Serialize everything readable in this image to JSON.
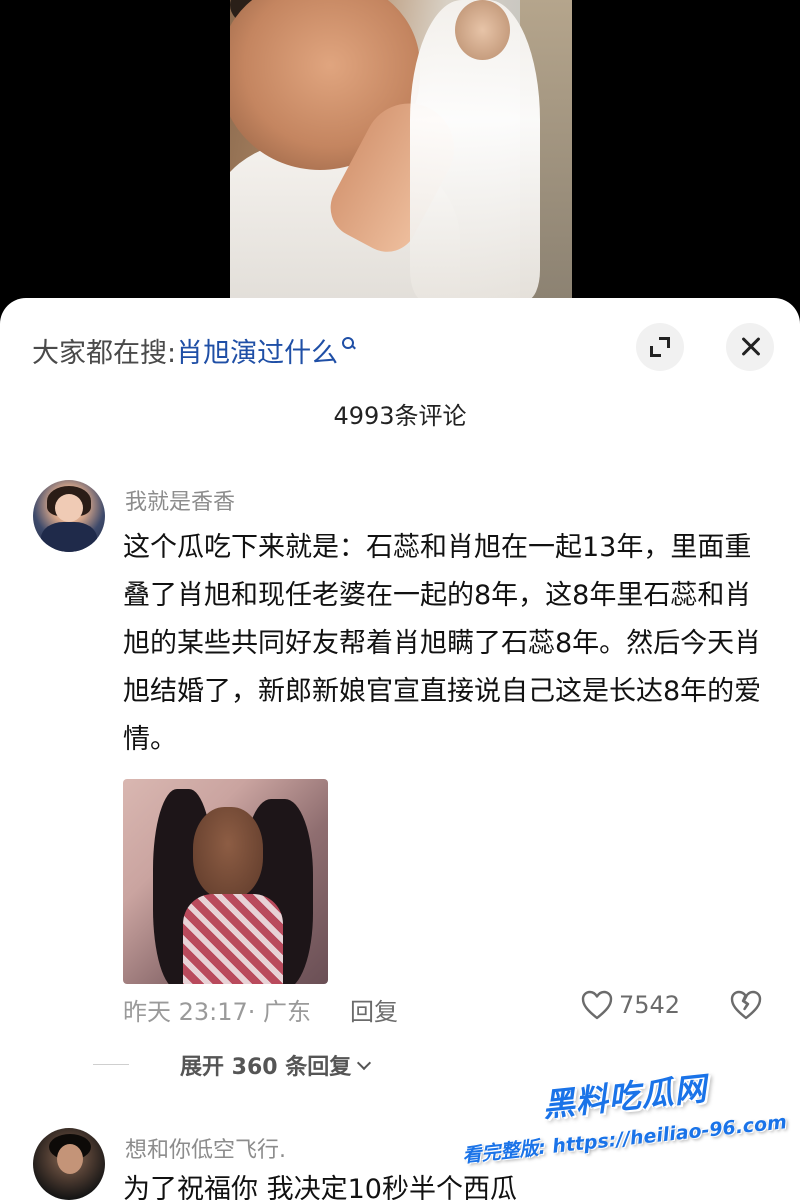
{
  "search": {
    "prefix": "大家都在搜:",
    "term": "肖旭演过什么"
  },
  "header": {
    "comment_count": "4993条评论"
  },
  "comments": [
    {
      "username": "我就是香香",
      "text": "这个瓜吃下来就是：石蕊和肖旭在一起13年，里面重叠了肖旭和现任老婆在一起的8年，这8年里石蕊和肖旭的某些共同好友帮着肖旭瞒了石蕊8年。然后今天肖旭结婚了，新郎新娘官宣直接说自己这是长达8年的爱情。",
      "time_location": "昨天 23:17· 广东",
      "reply_label": "回复",
      "likes": "7542",
      "expand_replies": "展开 360 条回复"
    },
    {
      "username": "想和你低空飞行.",
      "text": "为了祝福你 我决定10秒半个西瓜"
    }
  ],
  "watermark": {
    "title": "黑料吃瓜网",
    "url": "看完整版: https://heiliao-96.com"
  },
  "colors": {
    "accent_link": "#1f4fa6",
    "watermark": "#1a73e8",
    "muted_text": "#8c8c8c"
  }
}
